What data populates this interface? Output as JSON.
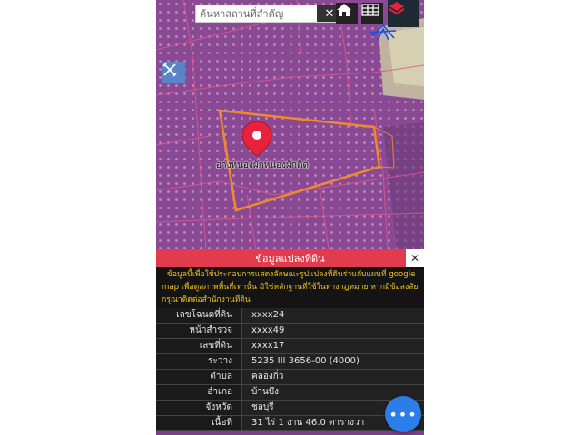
{
  "search": {
    "placeholder": "ค้นหาสถานที่สำคัญ",
    "clear_label": "✕"
  },
  "map": {
    "place_label": "อ่างหนองผักหนองผักติด"
  },
  "panel": {
    "title": "ข้อมูลแปลงที่ดิน",
    "close_label": "✕",
    "notice": "ข้อมูลนี้เพื่อใช้ประกอบการแสดงลักษณะรูปแปลงที่ดินร่วมกับแผนที่ google map เพื่อดูสภาพพื้นที่เท่านั้น มิใช่หลักฐานที่ใช้ในทางกฎหมาย หากมีข้อสงสัย กรุณาติดต่อสำนักงานที่ดิน",
    "rows": [
      {
        "label": "เลขโฉนดที่ดิน",
        "value": "xxxx24"
      },
      {
        "label": "หน้าสำรวจ",
        "value": "xxxx49"
      },
      {
        "label": "เลขที่ดิน",
        "value": "xxxx17"
      },
      {
        "label": "ระวาง",
        "value": "5235 III 3656-00 (4000)"
      },
      {
        "label": "ตำบล",
        "value": "คลองกิ่ว"
      },
      {
        "label": "อำเภอ",
        "value": "บ้านบึง"
      },
      {
        "label": "จังหวัด",
        "value": "ชลบุรี"
      },
      {
        "label": "เนื้อที่",
        "value": "31 ไร่ 1 งาน 46.0 ตารางวา"
      }
    ],
    "more_label": "•••"
  },
  "colors": {
    "header": "#e23b4e",
    "notice_text": "#f2c21b",
    "parcel_outline": "#f08a2a",
    "pin": "#e8213c",
    "fab": "#2b7de9"
  }
}
